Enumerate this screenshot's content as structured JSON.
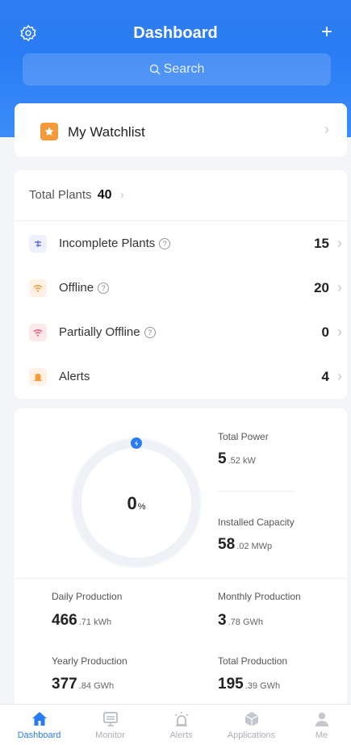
{
  "header": {
    "title": "Dashboard",
    "plus": "+",
    "search_placeholder": "Search"
  },
  "watchlist": {
    "label": "My Watchlist"
  },
  "plants": {
    "total_label": "Total Plants",
    "total_value": "40",
    "rows": [
      {
        "label": "Incomplete Plants",
        "value": "15",
        "icon": "incomplete-icon",
        "has_help": true,
        "color": "#5b6cf0"
      },
      {
        "label": "Offline",
        "value": "20",
        "icon": "wifi-icon",
        "has_help": true,
        "color": "#f49a3b"
      },
      {
        "label": "Partially Offline",
        "value": "0",
        "icon": "wifi-partial-icon",
        "has_help": true,
        "color": "#f05a6e"
      },
      {
        "label": "Alerts",
        "value": "4",
        "icon": "alert-icon",
        "has_help": false,
        "color": "#f49a3b"
      }
    ]
  },
  "production": {
    "ratio_value": "0",
    "ratio_unit": "%",
    "total_power": {
      "label": "Total Power",
      "value": "5",
      "decimals": ".52",
      "unit": "kW"
    },
    "installed_capacity": {
      "label": "Installed Capacity",
      "value": "58",
      "decimals": ".02",
      "unit": "MWp"
    },
    "daily": {
      "label": "Daily Production",
      "value": "466",
      "decimals": ".71",
      "unit": "kWh"
    },
    "monthly": {
      "label": "Monthly Production",
      "value": "3",
      "decimals": ".78",
      "unit": "GWh"
    },
    "yearly": {
      "label": "Yearly Production",
      "value": "377",
      "decimals": ".84",
      "unit": "GWh"
    },
    "total": {
      "label": "Total Production",
      "value": "195",
      "decimals": ".39",
      "unit": "GWh"
    }
  },
  "tabs": [
    {
      "label": "Dashboard",
      "icon": "home-icon",
      "active": true
    },
    {
      "label": "Monitor",
      "icon": "monitor-icon",
      "active": false
    },
    {
      "label": "Alerts",
      "icon": "siren-icon",
      "active": false
    },
    {
      "label": "Applications",
      "icon": "cube-icon",
      "active": false
    },
    {
      "label": "Me",
      "icon": "user-icon",
      "active": false
    }
  ],
  "colors": {
    "accent": "#2a7cf4",
    "watchlist": "#f49a3b"
  }
}
